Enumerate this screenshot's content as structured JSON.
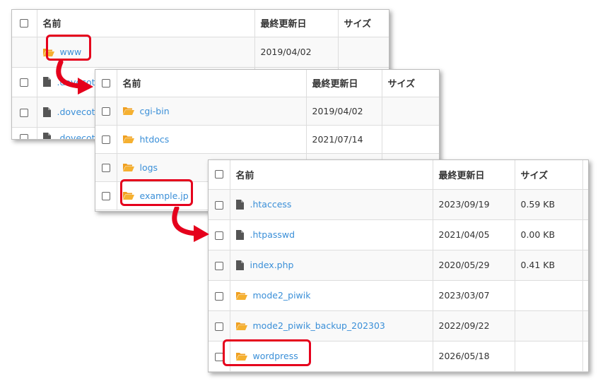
{
  "panel1": {
    "headers": {
      "name": "名前",
      "date": "最終更新日",
      "size": "サイズ"
    },
    "rows": [
      {
        "type": "folder",
        "name": "www",
        "date": "2019/04/02",
        "size": ""
      },
      {
        "type": "file",
        "name": ".dovecot",
        "date": "",
        "size": ""
      },
      {
        "type": "file",
        "name": ".dovecot",
        "date": "",
        "size": ""
      },
      {
        "type": "file",
        "name": ".dovecot",
        "date": "",
        "size": ""
      }
    ]
  },
  "panel2": {
    "headers": {
      "name": "名前",
      "date": "最終更新日",
      "size": "サイズ"
    },
    "rows": [
      {
        "type": "folder",
        "name": "cgi-bin",
        "date": "2019/04/02",
        "size": ""
      },
      {
        "type": "folder",
        "name": "htdocs",
        "date": "2021/07/14",
        "size": ""
      },
      {
        "type": "folder",
        "name": "logs",
        "date": "",
        "size": ""
      },
      {
        "type": "folder",
        "name": "example.jp",
        "date": "",
        "size": ""
      }
    ]
  },
  "panel3": {
    "headers": {
      "name": "名前",
      "date": "最終更新日",
      "size": "サイズ"
    },
    "rows": [
      {
        "type": "file",
        "name": ".htaccess",
        "date": "2023/09/19",
        "size": "0.59 KB"
      },
      {
        "type": "file",
        "name": ".htpasswd",
        "date": "2021/04/05",
        "size": "0.00 KB"
      },
      {
        "type": "file",
        "name": "index.php",
        "date": "2020/05/29",
        "size": "0.41 KB"
      },
      {
        "type": "folder",
        "name": "mode2_piwik",
        "date": "2023/03/07",
        "size": ""
      },
      {
        "type": "folder",
        "name": "mode2_piwik_backup_202303",
        "date": "2022/09/22",
        "size": ""
      },
      {
        "type": "folder",
        "name": "wordpress",
        "date": "2026/05/18",
        "size": ""
      }
    ]
  },
  "colors": {
    "link": "#3a8fd8",
    "folder": "#f0a020",
    "highlight": "#e5001c",
    "arrow": "#e5001c"
  },
  "icons": {
    "folder": "folder-open-icon",
    "file": "file-icon",
    "arrow": "curved-arrow-icon"
  }
}
